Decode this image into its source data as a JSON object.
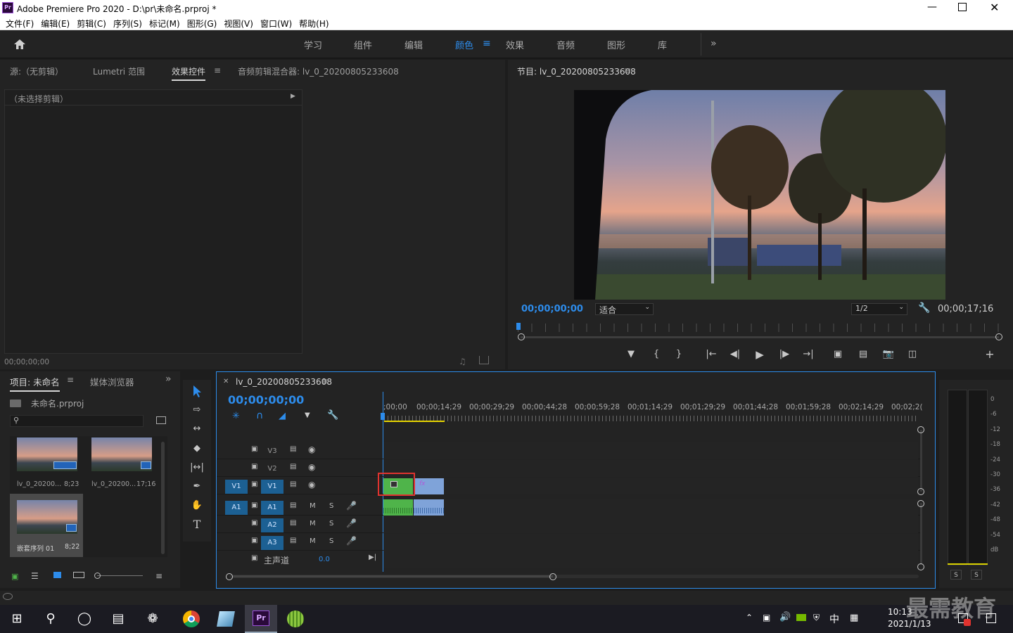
{
  "window": {
    "title": "Adobe Premiere Pro 2020 - D:\\pr\\未命名.prproj *",
    "app_icon": "Pr"
  },
  "menu": [
    "文件(F)",
    "编辑(E)",
    "剪辑(C)",
    "序列(S)",
    "标记(M)",
    "图形(G)",
    "视图(V)",
    "窗口(W)",
    "帮助(H)"
  ],
  "workspaces": [
    "学习",
    "组件",
    "编辑",
    "颜色",
    "效果",
    "音频",
    "图形",
    "库"
  ],
  "workspace_active": "颜色",
  "source_panel": {
    "tabs": [
      "源:（无剪辑）",
      "Lumetri 范围",
      "效果控件",
      "音频剪辑混合器: lv_0_20200805233608"
    ],
    "active_tab": "效果控件",
    "no_clip": "（未选择剪辑）",
    "timecode": "00;00;00;00"
  },
  "program": {
    "title": "节目: lv_0_20200805233608",
    "timecode": "00;00;00;00",
    "fit": "适合",
    "resolution": "1/2",
    "duration": "00;00;17;16"
  },
  "project": {
    "tabs": [
      "项目: 未命名",
      "媒体浏览器"
    ],
    "file": "未命名.prproj",
    "items": [
      {
        "name": "lv_0_20200...",
        "dur": "8;23"
      },
      {
        "name": "lv_0_20200...",
        "dur": "17;16"
      },
      {
        "name": "嵌套序列 01",
        "dur": "8;22"
      }
    ]
  },
  "timeline": {
    "seq": "lv_0_20200805233608",
    "timecode": "00;00;00;00",
    "ticks": [
      ";00;00",
      "00;00;14;29",
      "00;00;29;29",
      "00;00;44;28",
      "00;00;59;28",
      "00;01;14;29",
      "00;01;29;29",
      "00;01;44;28",
      "00;01;59;28",
      "00;02;14;29",
      "00;02;2("
    ],
    "tracks": [
      {
        "src": "",
        "name": "V3"
      },
      {
        "src": "",
        "name": "V2"
      },
      {
        "src": "V1",
        "name": "V1"
      },
      {
        "src": "A1",
        "name": "A1"
      },
      {
        "src": "",
        "name": "A2"
      },
      {
        "src": "",
        "name": "A3"
      }
    ],
    "mix": {
      "label": "主声道",
      "value": "0.0"
    },
    "m_label": "M",
    "s_label": "S"
  },
  "meter": {
    "labels": [
      "0",
      "-6",
      "-12",
      "-18",
      "-24",
      "-30",
      "-36",
      "-42",
      "-48",
      "-54",
      "dB"
    ],
    "solo": [
      "S",
      "S"
    ]
  },
  "taskbar": {
    "time": "10:13",
    "date": "2021/1/13",
    "ime": "中",
    "watermark": "最需教育"
  },
  "colors": {
    "accent": "#2d8ceb",
    "clip_green": "#4fb44a",
    "clip_blue": "#7fa3d9",
    "highlight": "#e0332f"
  }
}
